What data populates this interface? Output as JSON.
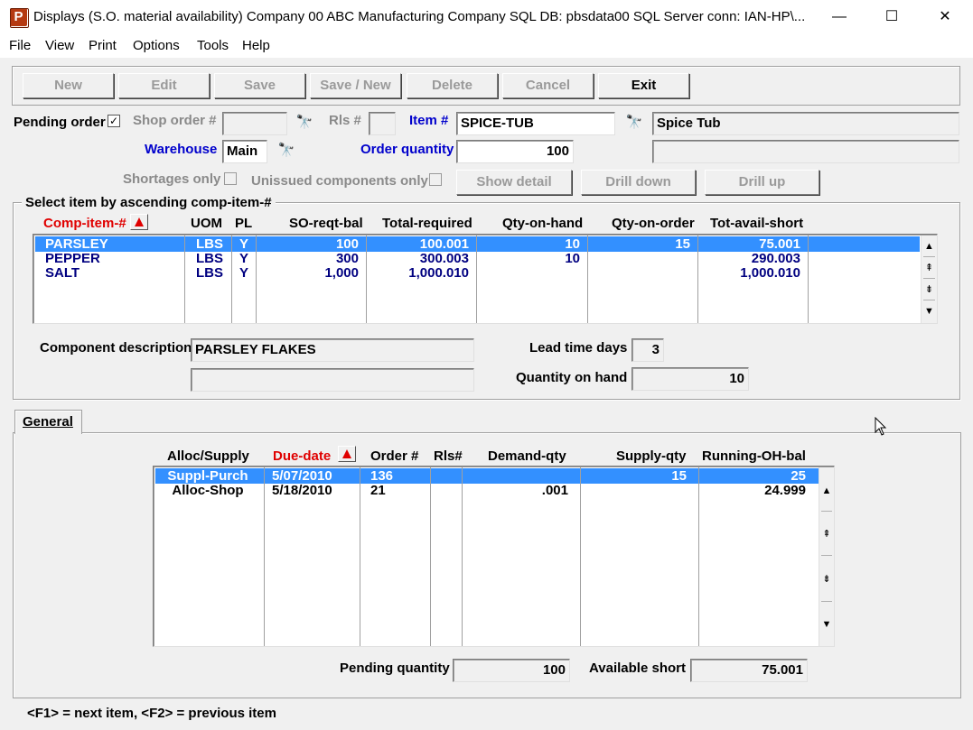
{
  "window": {
    "title": "Displays (S.O. material availability)      Company 00  ABC Manufacturing Company SQL DB: pbsdata00 SQL Server conn: IAN-HP\\...",
    "icon": "app-icon",
    "icon_letter": "P",
    "minimize": "—",
    "maximize": "☐",
    "close": "✕"
  },
  "menu": [
    "File",
    "View",
    "Print",
    "Options",
    "Tools",
    "Help"
  ],
  "toolbar": {
    "new": "New",
    "edit": "Edit",
    "save": "Save",
    "save_new": "Save / New",
    "delete": "Delete",
    "cancel": "Cancel",
    "exit": "Exit"
  },
  "form": {
    "pending_order_label": "Pending order",
    "pending_order_checked": "✓",
    "shop_order_label": "Shop order #",
    "shop_order_value": "",
    "rls_label": "Rls #",
    "rls_value": "",
    "item_label": "Item #",
    "item_value": "SPICE-TUB",
    "item_description": "Spice Tub",
    "item_description2": "",
    "warehouse_label": "Warehouse",
    "warehouse_value": "Main",
    "order_qty_label": "Order quantity",
    "order_qty_value": "100",
    "shortages_only_label": "Shortages only",
    "unissued_label": "Unissued components only",
    "show_detail": "Show detail",
    "drill_down": "Drill down",
    "drill_up": "Drill up",
    "binoculars": "🔭"
  },
  "components": {
    "group_label": "Select item by ascending comp-item-#",
    "columns": [
      "Comp-item-#",
      "UOM",
      "PL",
      "SO-reqt-bal",
      "Total-required",
      "Qty-on-hand",
      "Qty-on-order",
      "Tot-avail-short"
    ],
    "rows": [
      [
        "PARSLEY",
        "LBS",
        "Y",
        "100",
        "100.001",
        "10",
        "15",
        "75.001"
      ],
      [
        "PEPPER",
        "LBS",
        "Y",
        "300",
        "300.003",
        "10",
        "",
        "290.003"
      ],
      [
        "SALT",
        "LBS",
        "Y",
        "1,000",
        "1,000.010",
        "",
        "",
        "1,000.010"
      ]
    ],
    "selected_row": 0
  },
  "detail": {
    "component_description_label": "Component description",
    "component_description": "PARSLEY FLAKES",
    "component_description2": "",
    "lead_time_label": "Lead time days",
    "lead_time_value": "3",
    "qty_on_hand_label": "Quantity on hand",
    "qty_on_hand_value": "10"
  },
  "tab": {
    "general": "General"
  },
  "transactions": {
    "columns": [
      "Alloc/Supply",
      "Due-date",
      "Order #",
      "Rls#",
      "Demand-qty",
      "Supply-qty",
      "Running-OH-bal"
    ],
    "rows": [
      [
        "Suppl-Purch",
        "5/07/2010",
        "136",
        "",
        "",
        "15",
        "25"
      ],
      [
        "Alloc-Shop",
        "5/18/2010",
        "21",
        "",
        ".001",
        "",
        "24.999"
      ]
    ],
    "selected_row": 0
  },
  "footer": {
    "pending_qty_label": "Pending quantity",
    "pending_qty_value": "100",
    "available_short_label": "Available short",
    "available_short_value": "75.001",
    "status": "<F1> = next item, <F2> = previous item"
  },
  "colors": {
    "selection": "#3390ff",
    "accent_blue": "#0000cc",
    "accent_red": "#e00000",
    "data_navy": "#000080"
  }
}
